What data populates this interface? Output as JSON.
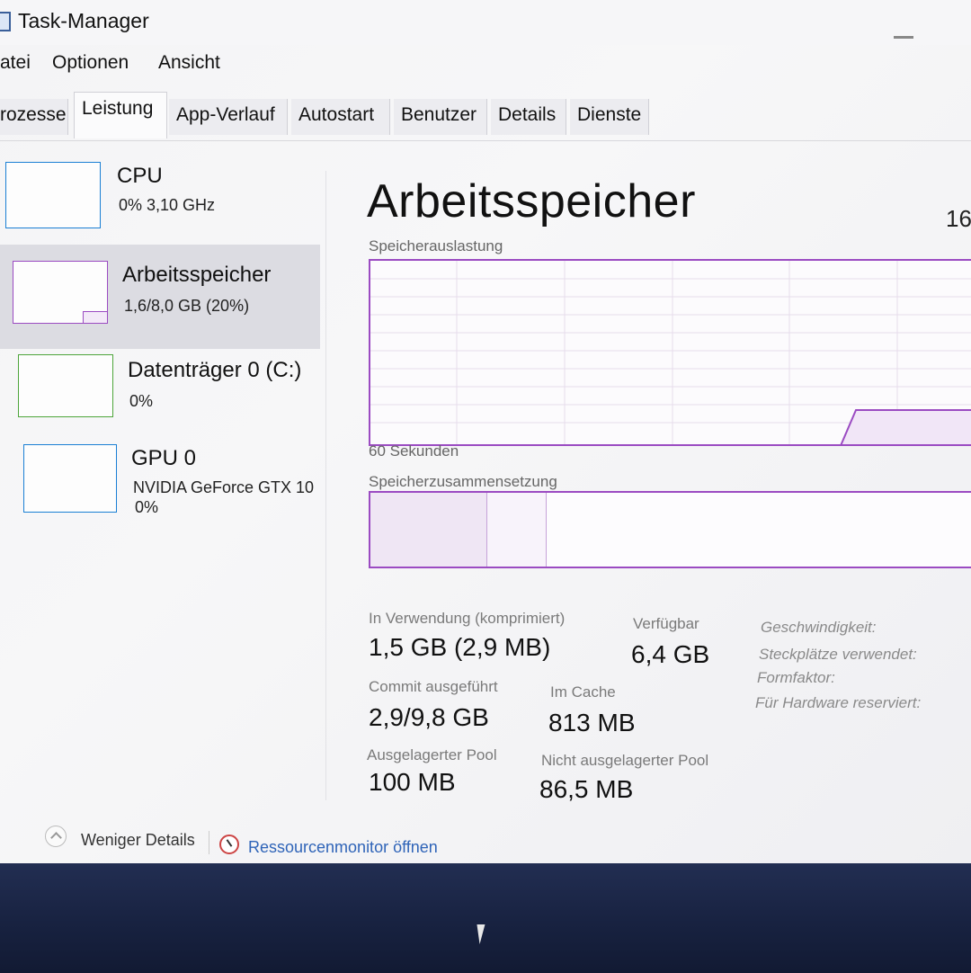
{
  "window": {
    "title": "Task-Manager"
  },
  "menu": [
    "atei",
    "Optionen",
    "Ansicht"
  ],
  "tabs": [
    "rozesse",
    "Leistung",
    "App-Verlauf",
    "Autostart",
    "Benutzer",
    "Details",
    "Dienste"
  ],
  "active_tab": "Leistung",
  "sidebar": {
    "items": [
      {
        "name": "CPU",
        "sub1": "0% 3,10 GHz",
        "sub2": "",
        "color": "#1a7fd4"
      },
      {
        "name": "Arbeitsspeicher",
        "sub1": "1,6/8,0 GB (20%)",
        "sub2": "",
        "color": "#9b4bc2",
        "selected": true
      },
      {
        "name": "Datenträger 0 (C:)",
        "sub1": "0%",
        "sub2": "",
        "color": "#4da53a"
      },
      {
        "name": "GPU 0",
        "sub1": "NVIDIA GeForce GTX 10",
        "sub2": "0%",
        "color": "#1a7fd4"
      }
    ]
  },
  "main": {
    "title": "Arbeitsspeicher",
    "right_value": "16",
    "usage_label": "Speicherauslastung",
    "time_label": "60 Sekunden",
    "composition_label": "Speicherzusammensetzung",
    "usage_fraction": 0.2,
    "accent_color": "#9b4bc2"
  },
  "stats": {
    "in_use_label": "In Verwendung (komprimiert)",
    "in_use_value": "1,5 GB (2,9 MB)",
    "available_label": "Verfügbar",
    "available_value": "6,4 GB",
    "commit_label": "Commit ausgeführt",
    "commit_value": "2,9/9,8 GB",
    "cache_label": "Im Cache",
    "cache_value": "813 MB",
    "paged_label": "Ausgelagerter Pool",
    "paged_value": "100 MB",
    "nonpaged_label": "Nicht ausgelagerter Pool",
    "nonpaged_value": "86,5 MB"
  },
  "specs": {
    "speed_label": "Geschwindigkeit:",
    "slots_label": "Steckplätze verwendet:",
    "form_label": "Formfaktor:",
    "reserved_label": "Für Hardware reserviert:"
  },
  "footer": {
    "less_details": "Weniger Details",
    "resource_monitor": "Ressourcenmonitor öffnen"
  }
}
